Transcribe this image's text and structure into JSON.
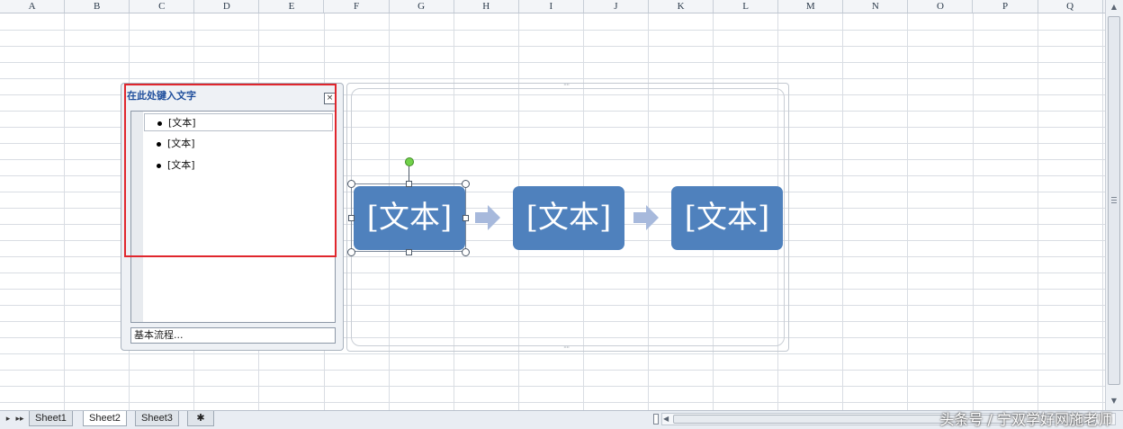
{
  "columns": [
    "A",
    "B",
    "C",
    "D",
    "E",
    "F",
    "G",
    "H",
    "I",
    "J",
    "K",
    "L",
    "M",
    "N",
    "O",
    "P",
    "Q"
  ],
  "text_pane": {
    "title": "在此处键入文字",
    "close_glyph": "×",
    "items": [
      {
        "label": "[文本]"
      },
      {
        "label": "[文本]"
      },
      {
        "label": "[文本]"
      }
    ],
    "footer": "基本流程..."
  },
  "smartart": {
    "shapes": [
      {
        "label": "[文本]"
      },
      {
        "label": "[文本]"
      },
      {
        "label": "[文本]"
      }
    ],
    "colors": {
      "shape_fill": "#4f81bd",
      "arrow_fill": "#a7b9dc",
      "highlight": "#e0262d"
    }
  },
  "sheets": {
    "tabs": [
      {
        "label": "Sheet1",
        "active": false
      },
      {
        "label": "Sheet2",
        "active": true
      },
      {
        "label": "Sheet3",
        "active": false
      }
    ],
    "insert_icon": "insert-sheet-icon"
  },
  "watermark": "头条号 / 宁双学好网施老师"
}
